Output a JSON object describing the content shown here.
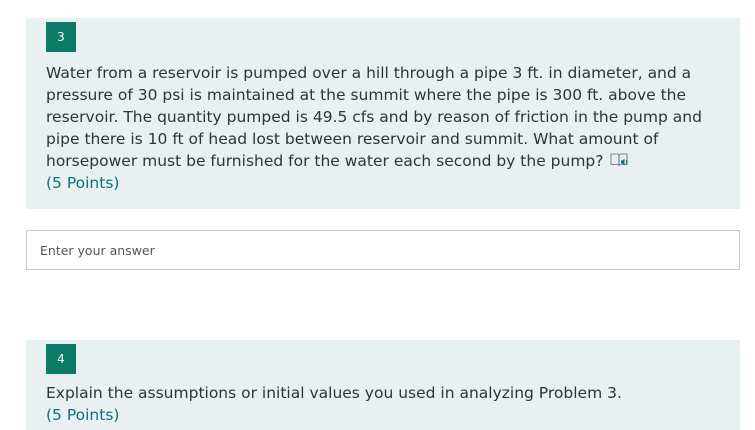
{
  "questions": [
    {
      "number": "3",
      "text": "Water from a reservoir is pumped over a hill through a pipe 3 ft. in diameter, and a pressure of 30 psi is maintained at the summit where the pipe is 300 ft. above the reservoir. The quantity pumped is 49.5 cfs and by reason of friction in the pump and pipe there is 10 ft of head lost between reservoir and summit. What amount of horsepower must be furnished for the water each second by the pump?",
      "points": "(5 Points)",
      "icon": "immersive-reader-icon"
    },
    {
      "number": "4",
      "text": "Explain the assumptions or initial values you used in analyzing Problem 3.",
      "points": "(5 Points)"
    }
  ],
  "answer": {
    "placeholder": "Enter your answer",
    "value": ""
  },
  "colors": {
    "card_background": "#e8f0f2",
    "number_badge": "#0b7a66",
    "points_text": "#0f6f7f",
    "icon_accent": "#0f6f7f"
  }
}
